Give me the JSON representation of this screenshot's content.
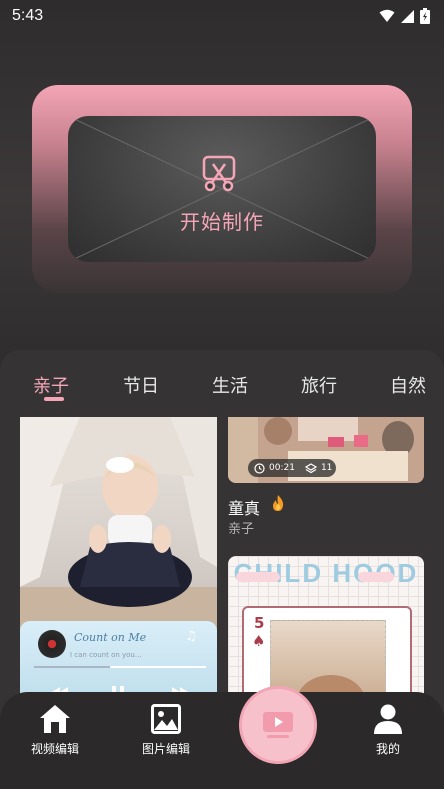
{
  "status_bar": {
    "time": "5:43"
  },
  "create_card": {
    "label": "开始制作"
  },
  "tabs": [
    {
      "label": "亲子",
      "active": true
    },
    {
      "label": "节日",
      "active": false
    },
    {
      "label": "生活",
      "active": false
    },
    {
      "label": "旅行",
      "active": false
    },
    {
      "label": "自然",
      "active": false
    }
  ],
  "templates": {
    "left_card": {
      "music_title": "Count on Me",
      "music_subtitle": "I can count on you..."
    },
    "right_card": {
      "duration": "00:21",
      "layers": "11",
      "title": "童真",
      "subtitle": "亲子"
    },
    "right_bottom_card": {
      "banner_text": "CHILD HOOD",
      "card_number": "5",
      "card_suit": "♠"
    }
  },
  "bottom_nav": [
    {
      "label": "视频编辑",
      "icon": "home-icon"
    },
    {
      "label": "图片编辑",
      "icon": "image-icon"
    },
    {
      "label": "",
      "icon": "play-icon"
    },
    {
      "label": "我的",
      "icon": "user-icon"
    }
  ],
  "colors": {
    "accent": "#f4a6b6",
    "background": "#2f2d2e"
  }
}
